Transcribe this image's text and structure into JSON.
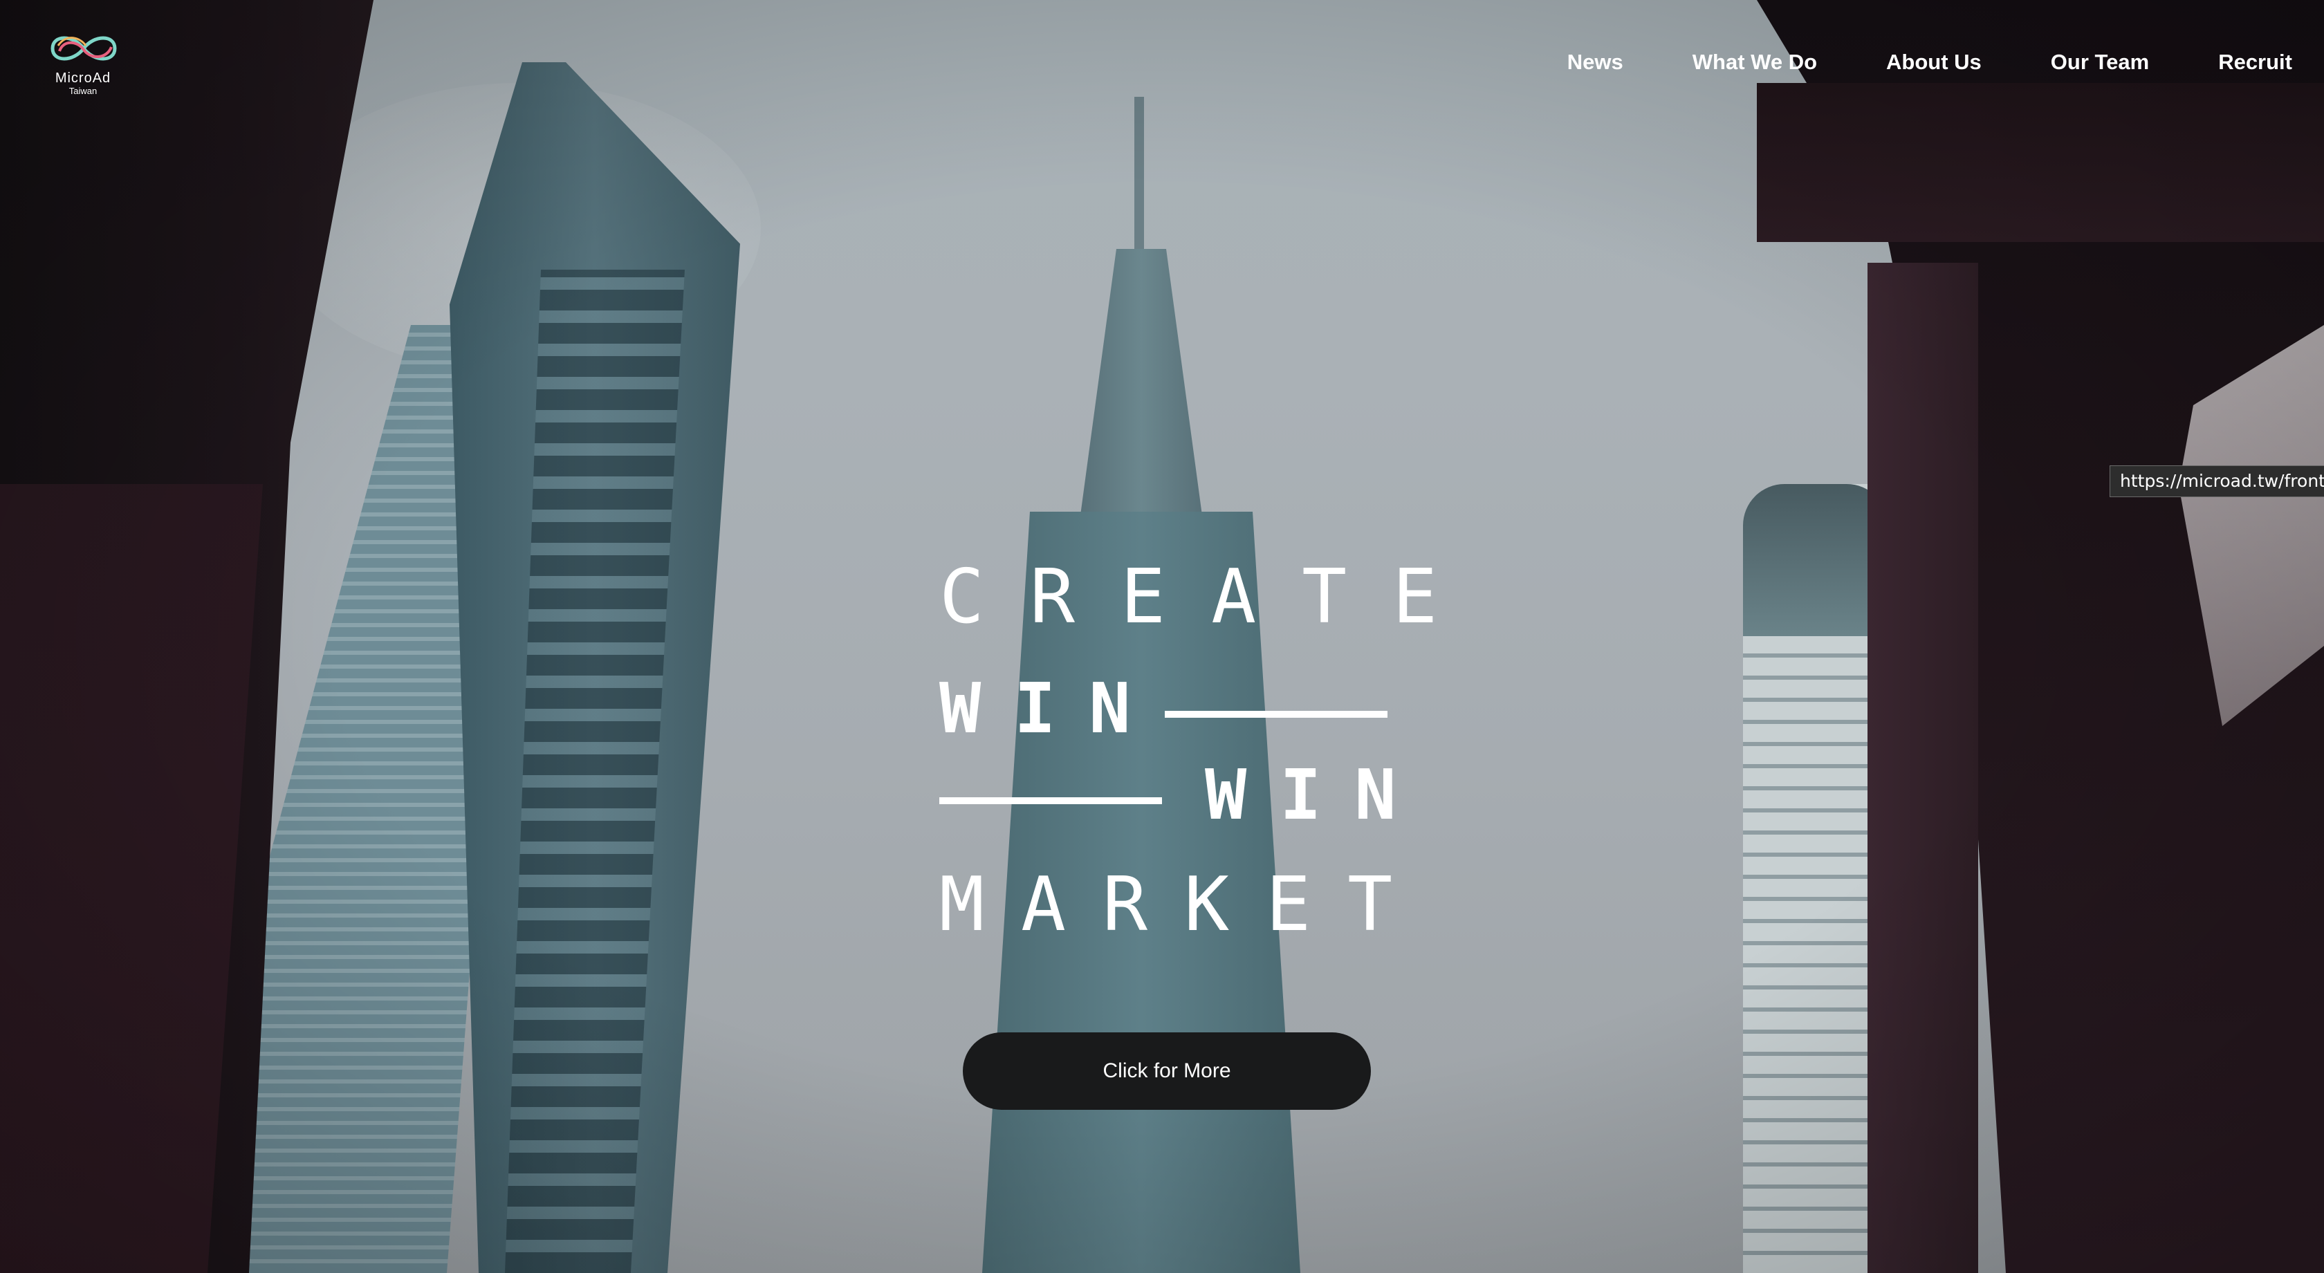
{
  "brand": {
    "name": "MicroAd",
    "subtitle": "Taiwan",
    "logo_icon": "infinity-logo-icon"
  },
  "nav": {
    "items": [
      {
        "label": "News"
      },
      {
        "label": "What We Do"
      },
      {
        "label": "About Us"
      },
      {
        "label": "Our Team"
      },
      {
        "label": "Recruit"
      }
    ]
  },
  "hero": {
    "line1": "CREATE",
    "line2": "WIN",
    "line3": "WIN",
    "line4": "MARKET",
    "cta_label": "Click for More"
  },
  "status_tooltip": {
    "url": "https://microad.tw/fronte"
  },
  "colors": {
    "nav_text": "#ffffff",
    "cta_bg": "#191a1b",
    "cta_text": "#ffffff"
  }
}
